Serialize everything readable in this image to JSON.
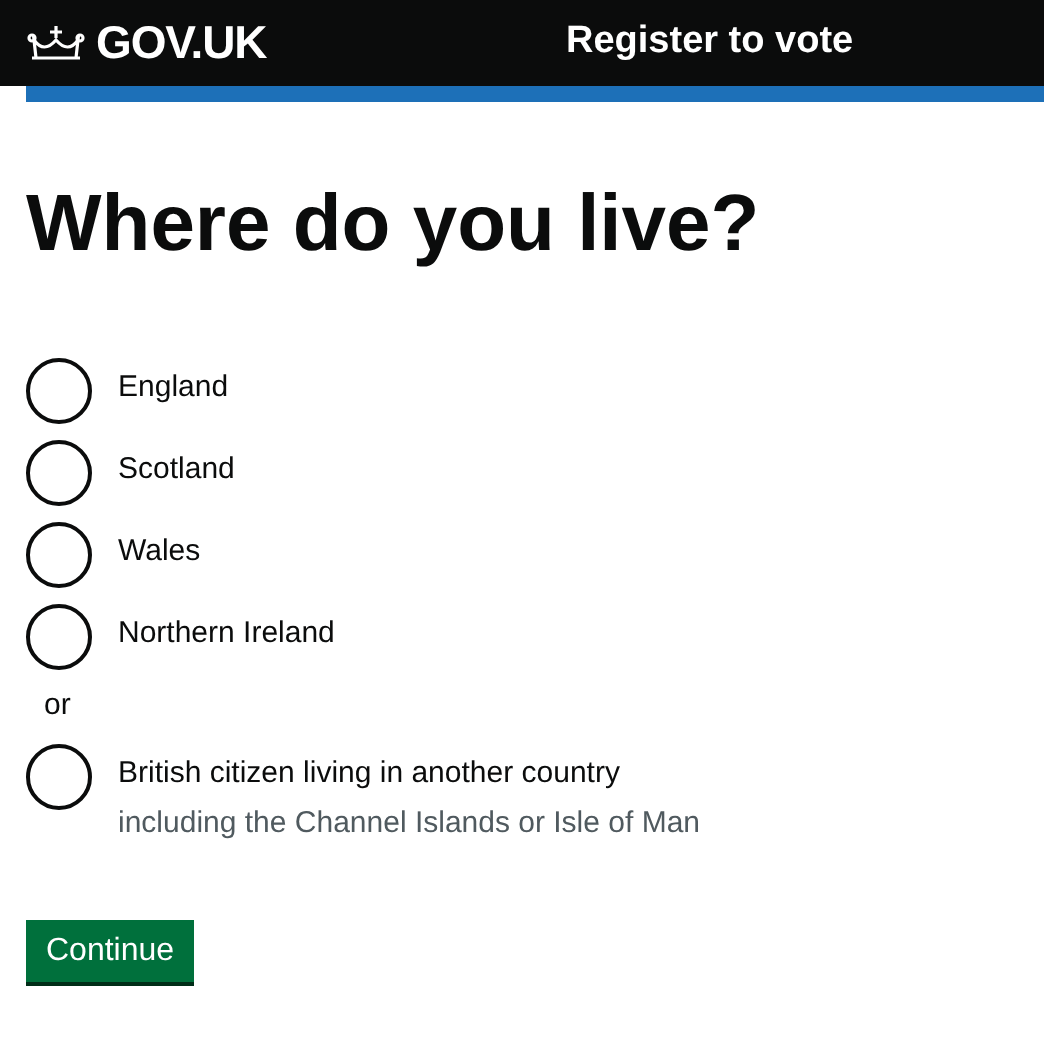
{
  "header": {
    "logo": "GOV.UK",
    "service": "Register to vote"
  },
  "heading": "Where do you live?",
  "options": [
    {
      "kind": "radio",
      "label": "England",
      "selected": false
    },
    {
      "kind": "radio",
      "label": "Scotland",
      "selected": false
    },
    {
      "kind": "radio",
      "label": "Wales",
      "selected": false
    },
    {
      "kind": "radio",
      "label": "Northern Ireland",
      "selected": false
    },
    {
      "kind": "divider",
      "text": "or"
    },
    {
      "kind": "radio",
      "label": "British citizen living in another country",
      "hint": "including the Channel Islands or Isle of Man",
      "selected": false
    }
  ],
  "button": "Continue"
}
